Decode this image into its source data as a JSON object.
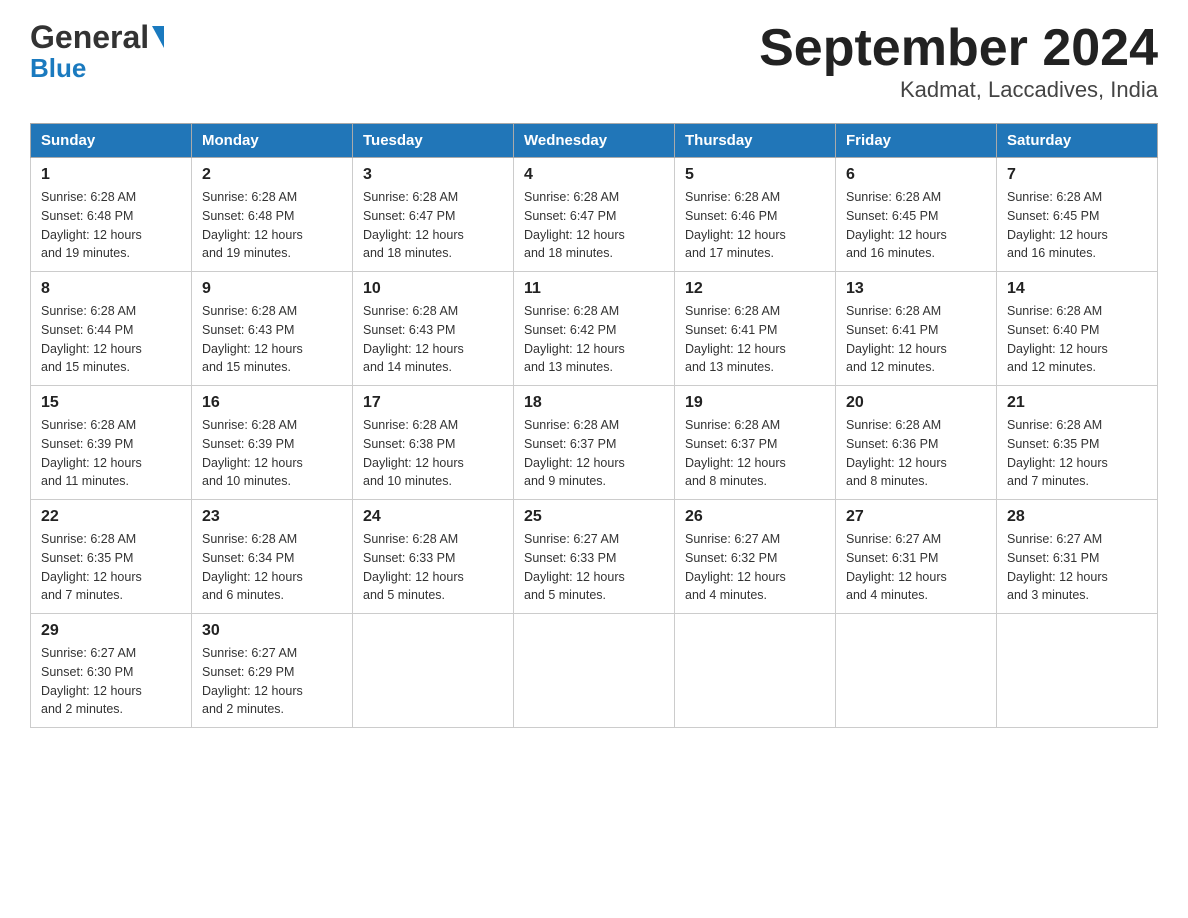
{
  "header": {
    "logo_general": "General",
    "logo_blue": "Blue",
    "title": "September 2024",
    "subtitle": "Kadmat, Laccadives, India"
  },
  "days_of_week": [
    "Sunday",
    "Monday",
    "Tuesday",
    "Wednesday",
    "Thursday",
    "Friday",
    "Saturday"
  ],
  "weeks": [
    [
      {
        "day": "1",
        "sunrise": "6:28 AM",
        "sunset": "6:48 PM",
        "daylight": "12 hours and 19 minutes."
      },
      {
        "day": "2",
        "sunrise": "6:28 AM",
        "sunset": "6:48 PM",
        "daylight": "12 hours and 19 minutes."
      },
      {
        "day": "3",
        "sunrise": "6:28 AM",
        "sunset": "6:47 PM",
        "daylight": "12 hours and 18 minutes."
      },
      {
        "day": "4",
        "sunrise": "6:28 AM",
        "sunset": "6:47 PM",
        "daylight": "12 hours and 18 minutes."
      },
      {
        "day": "5",
        "sunrise": "6:28 AM",
        "sunset": "6:46 PM",
        "daylight": "12 hours and 17 minutes."
      },
      {
        "day": "6",
        "sunrise": "6:28 AM",
        "sunset": "6:45 PM",
        "daylight": "12 hours and 16 minutes."
      },
      {
        "day": "7",
        "sunrise": "6:28 AM",
        "sunset": "6:45 PM",
        "daylight": "12 hours and 16 minutes."
      }
    ],
    [
      {
        "day": "8",
        "sunrise": "6:28 AM",
        "sunset": "6:44 PM",
        "daylight": "12 hours and 15 minutes."
      },
      {
        "day": "9",
        "sunrise": "6:28 AM",
        "sunset": "6:43 PM",
        "daylight": "12 hours and 15 minutes."
      },
      {
        "day": "10",
        "sunrise": "6:28 AM",
        "sunset": "6:43 PM",
        "daylight": "12 hours and 14 minutes."
      },
      {
        "day": "11",
        "sunrise": "6:28 AM",
        "sunset": "6:42 PM",
        "daylight": "12 hours and 13 minutes."
      },
      {
        "day": "12",
        "sunrise": "6:28 AM",
        "sunset": "6:41 PM",
        "daylight": "12 hours and 13 minutes."
      },
      {
        "day": "13",
        "sunrise": "6:28 AM",
        "sunset": "6:41 PM",
        "daylight": "12 hours and 12 minutes."
      },
      {
        "day": "14",
        "sunrise": "6:28 AM",
        "sunset": "6:40 PM",
        "daylight": "12 hours and 12 minutes."
      }
    ],
    [
      {
        "day": "15",
        "sunrise": "6:28 AM",
        "sunset": "6:39 PM",
        "daylight": "12 hours and 11 minutes."
      },
      {
        "day": "16",
        "sunrise": "6:28 AM",
        "sunset": "6:39 PM",
        "daylight": "12 hours and 10 minutes."
      },
      {
        "day": "17",
        "sunrise": "6:28 AM",
        "sunset": "6:38 PM",
        "daylight": "12 hours and 10 minutes."
      },
      {
        "day": "18",
        "sunrise": "6:28 AM",
        "sunset": "6:37 PM",
        "daylight": "12 hours and 9 minutes."
      },
      {
        "day": "19",
        "sunrise": "6:28 AM",
        "sunset": "6:37 PM",
        "daylight": "12 hours and 8 minutes."
      },
      {
        "day": "20",
        "sunrise": "6:28 AM",
        "sunset": "6:36 PM",
        "daylight": "12 hours and 8 minutes."
      },
      {
        "day": "21",
        "sunrise": "6:28 AM",
        "sunset": "6:35 PM",
        "daylight": "12 hours and 7 minutes."
      }
    ],
    [
      {
        "day": "22",
        "sunrise": "6:28 AM",
        "sunset": "6:35 PM",
        "daylight": "12 hours and 7 minutes."
      },
      {
        "day": "23",
        "sunrise": "6:28 AM",
        "sunset": "6:34 PM",
        "daylight": "12 hours and 6 minutes."
      },
      {
        "day": "24",
        "sunrise": "6:28 AM",
        "sunset": "6:33 PM",
        "daylight": "12 hours and 5 minutes."
      },
      {
        "day": "25",
        "sunrise": "6:27 AM",
        "sunset": "6:33 PM",
        "daylight": "12 hours and 5 minutes."
      },
      {
        "day": "26",
        "sunrise": "6:27 AM",
        "sunset": "6:32 PM",
        "daylight": "12 hours and 4 minutes."
      },
      {
        "day": "27",
        "sunrise": "6:27 AM",
        "sunset": "6:31 PM",
        "daylight": "12 hours and 4 minutes."
      },
      {
        "day": "28",
        "sunrise": "6:27 AM",
        "sunset": "6:31 PM",
        "daylight": "12 hours and 3 minutes."
      }
    ],
    [
      {
        "day": "29",
        "sunrise": "6:27 AM",
        "sunset": "6:30 PM",
        "daylight": "12 hours and 2 minutes."
      },
      {
        "day": "30",
        "sunrise": "6:27 AM",
        "sunset": "6:29 PM",
        "daylight": "12 hours and 2 minutes."
      },
      {
        "day": "",
        "sunrise": "",
        "sunset": "",
        "daylight": ""
      },
      {
        "day": "",
        "sunrise": "",
        "sunset": "",
        "daylight": ""
      },
      {
        "day": "",
        "sunrise": "",
        "sunset": "",
        "daylight": ""
      },
      {
        "day": "",
        "sunrise": "",
        "sunset": "",
        "daylight": ""
      },
      {
        "day": "",
        "sunrise": "",
        "sunset": "",
        "daylight": ""
      }
    ]
  ],
  "labels": {
    "sunrise_prefix": "Sunrise: ",
    "sunset_prefix": "Sunset: ",
    "daylight_prefix": "Daylight: "
  }
}
